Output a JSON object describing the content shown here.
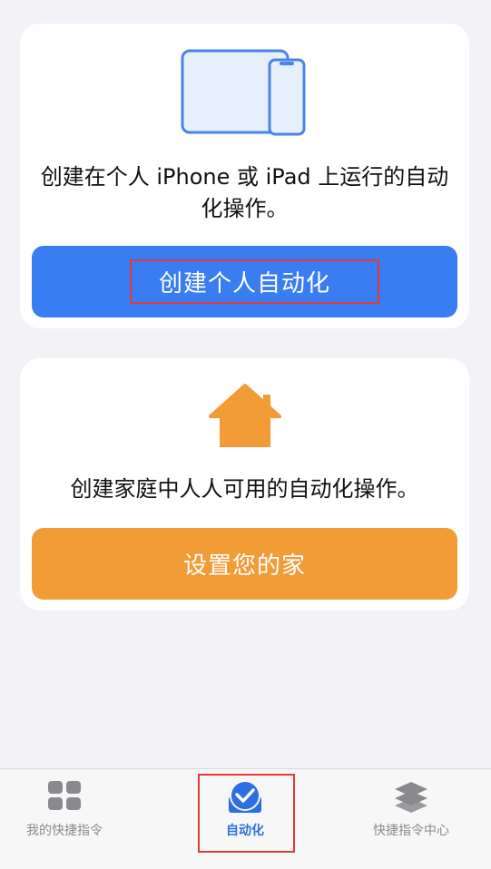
{
  "personal_card": {
    "description": "创建在个人 iPhone 或 iPad 上运行的自动化操作。",
    "button_label": "创建个人自动化",
    "illustration_icon": "iphone-ipad-icon"
  },
  "home_card": {
    "description": "创建家庭中人人可用的自动化操作。",
    "button_label": "设置您的家",
    "illustration_icon": "house-icon"
  },
  "tabbar": {
    "tabs": [
      {
        "label": "我的快捷指令",
        "icon": "grid-icon",
        "active": false
      },
      {
        "label": "自动化",
        "icon": "checkmark-circle-icon",
        "active": true
      },
      {
        "label": "快捷指令中心",
        "icon": "layers-icon",
        "active": false
      }
    ]
  },
  "colors": {
    "background": "#f2f2f7",
    "blue": "#3a7df2",
    "orange": "#f19c37",
    "highlight_red": "#e03a3a",
    "inactive_tab": "#8a8a8e"
  }
}
